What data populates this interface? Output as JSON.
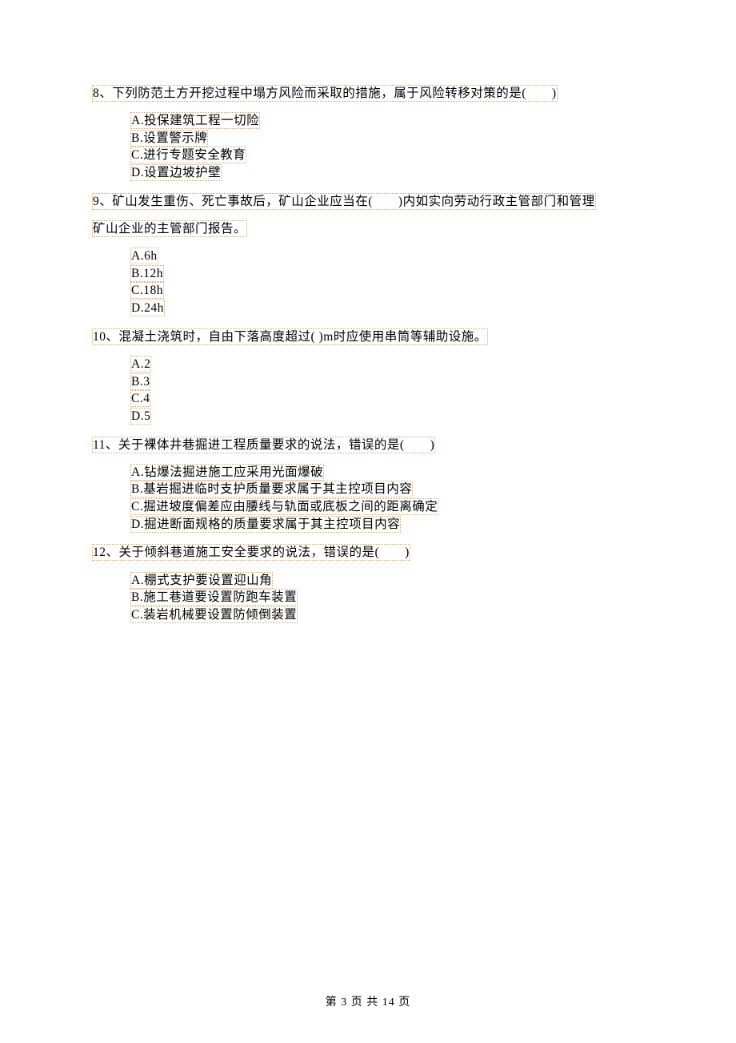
{
  "questions": [
    {
      "num": "8",
      "text": "8、下列防范土方开挖过程中塌方风险而采取的措施，属于风险转移对策的是(　　)",
      "options": [
        "A.投保建筑工程一切险",
        "B.设置警示牌",
        "C.进行专题安全教育",
        "D.设置边坡护壁"
      ]
    },
    {
      "num": "9",
      "text_line1": "9、矿山发生重伤、死亡事故后，矿山企业应当在(　　)内如实向劳动行政主管部门和管理",
      "text_line2": "矿山企业的主管部门报告。",
      "options": [
        "A.6h",
        "B.12h",
        "C.18h",
        "D.24h"
      ]
    },
    {
      "num": "10",
      "text": "10、混凝土浇筑时，自由下落高度超过( )m时应使用串筒等辅助设施。",
      "options": [
        "A.2 ",
        "B.3 ",
        "C.4 ",
        "D.5"
      ]
    },
    {
      "num": "11",
      "text": "11、关于裸体井巷掘进工程质量要求的说法，错误的是(　　)",
      "options": [
        "A.钻爆法掘进施工应采用光面爆破",
        "B.基岩掘进临时支护质量要求属于其主控项目内容",
        "C.掘进坡度偏差应由腰线与轨面或底板之间的距离确定",
        "D.掘进断面规格的质量要求属于其主控项目内容"
      ]
    },
    {
      "num": "12",
      "text": "12、关于倾斜巷道施工安全要求的说法，错误的是(　　)",
      "options": [
        "A.棚式支护要设置迎山角",
        "B.施工巷道要设置防跑车装置",
        "C.装岩机械要设置防倾倒装置"
      ]
    }
  ],
  "footer": {
    "prefix": "第 ",
    "current": "3",
    "middle": " 页 共 ",
    "total": "14",
    "suffix": " 页"
  }
}
